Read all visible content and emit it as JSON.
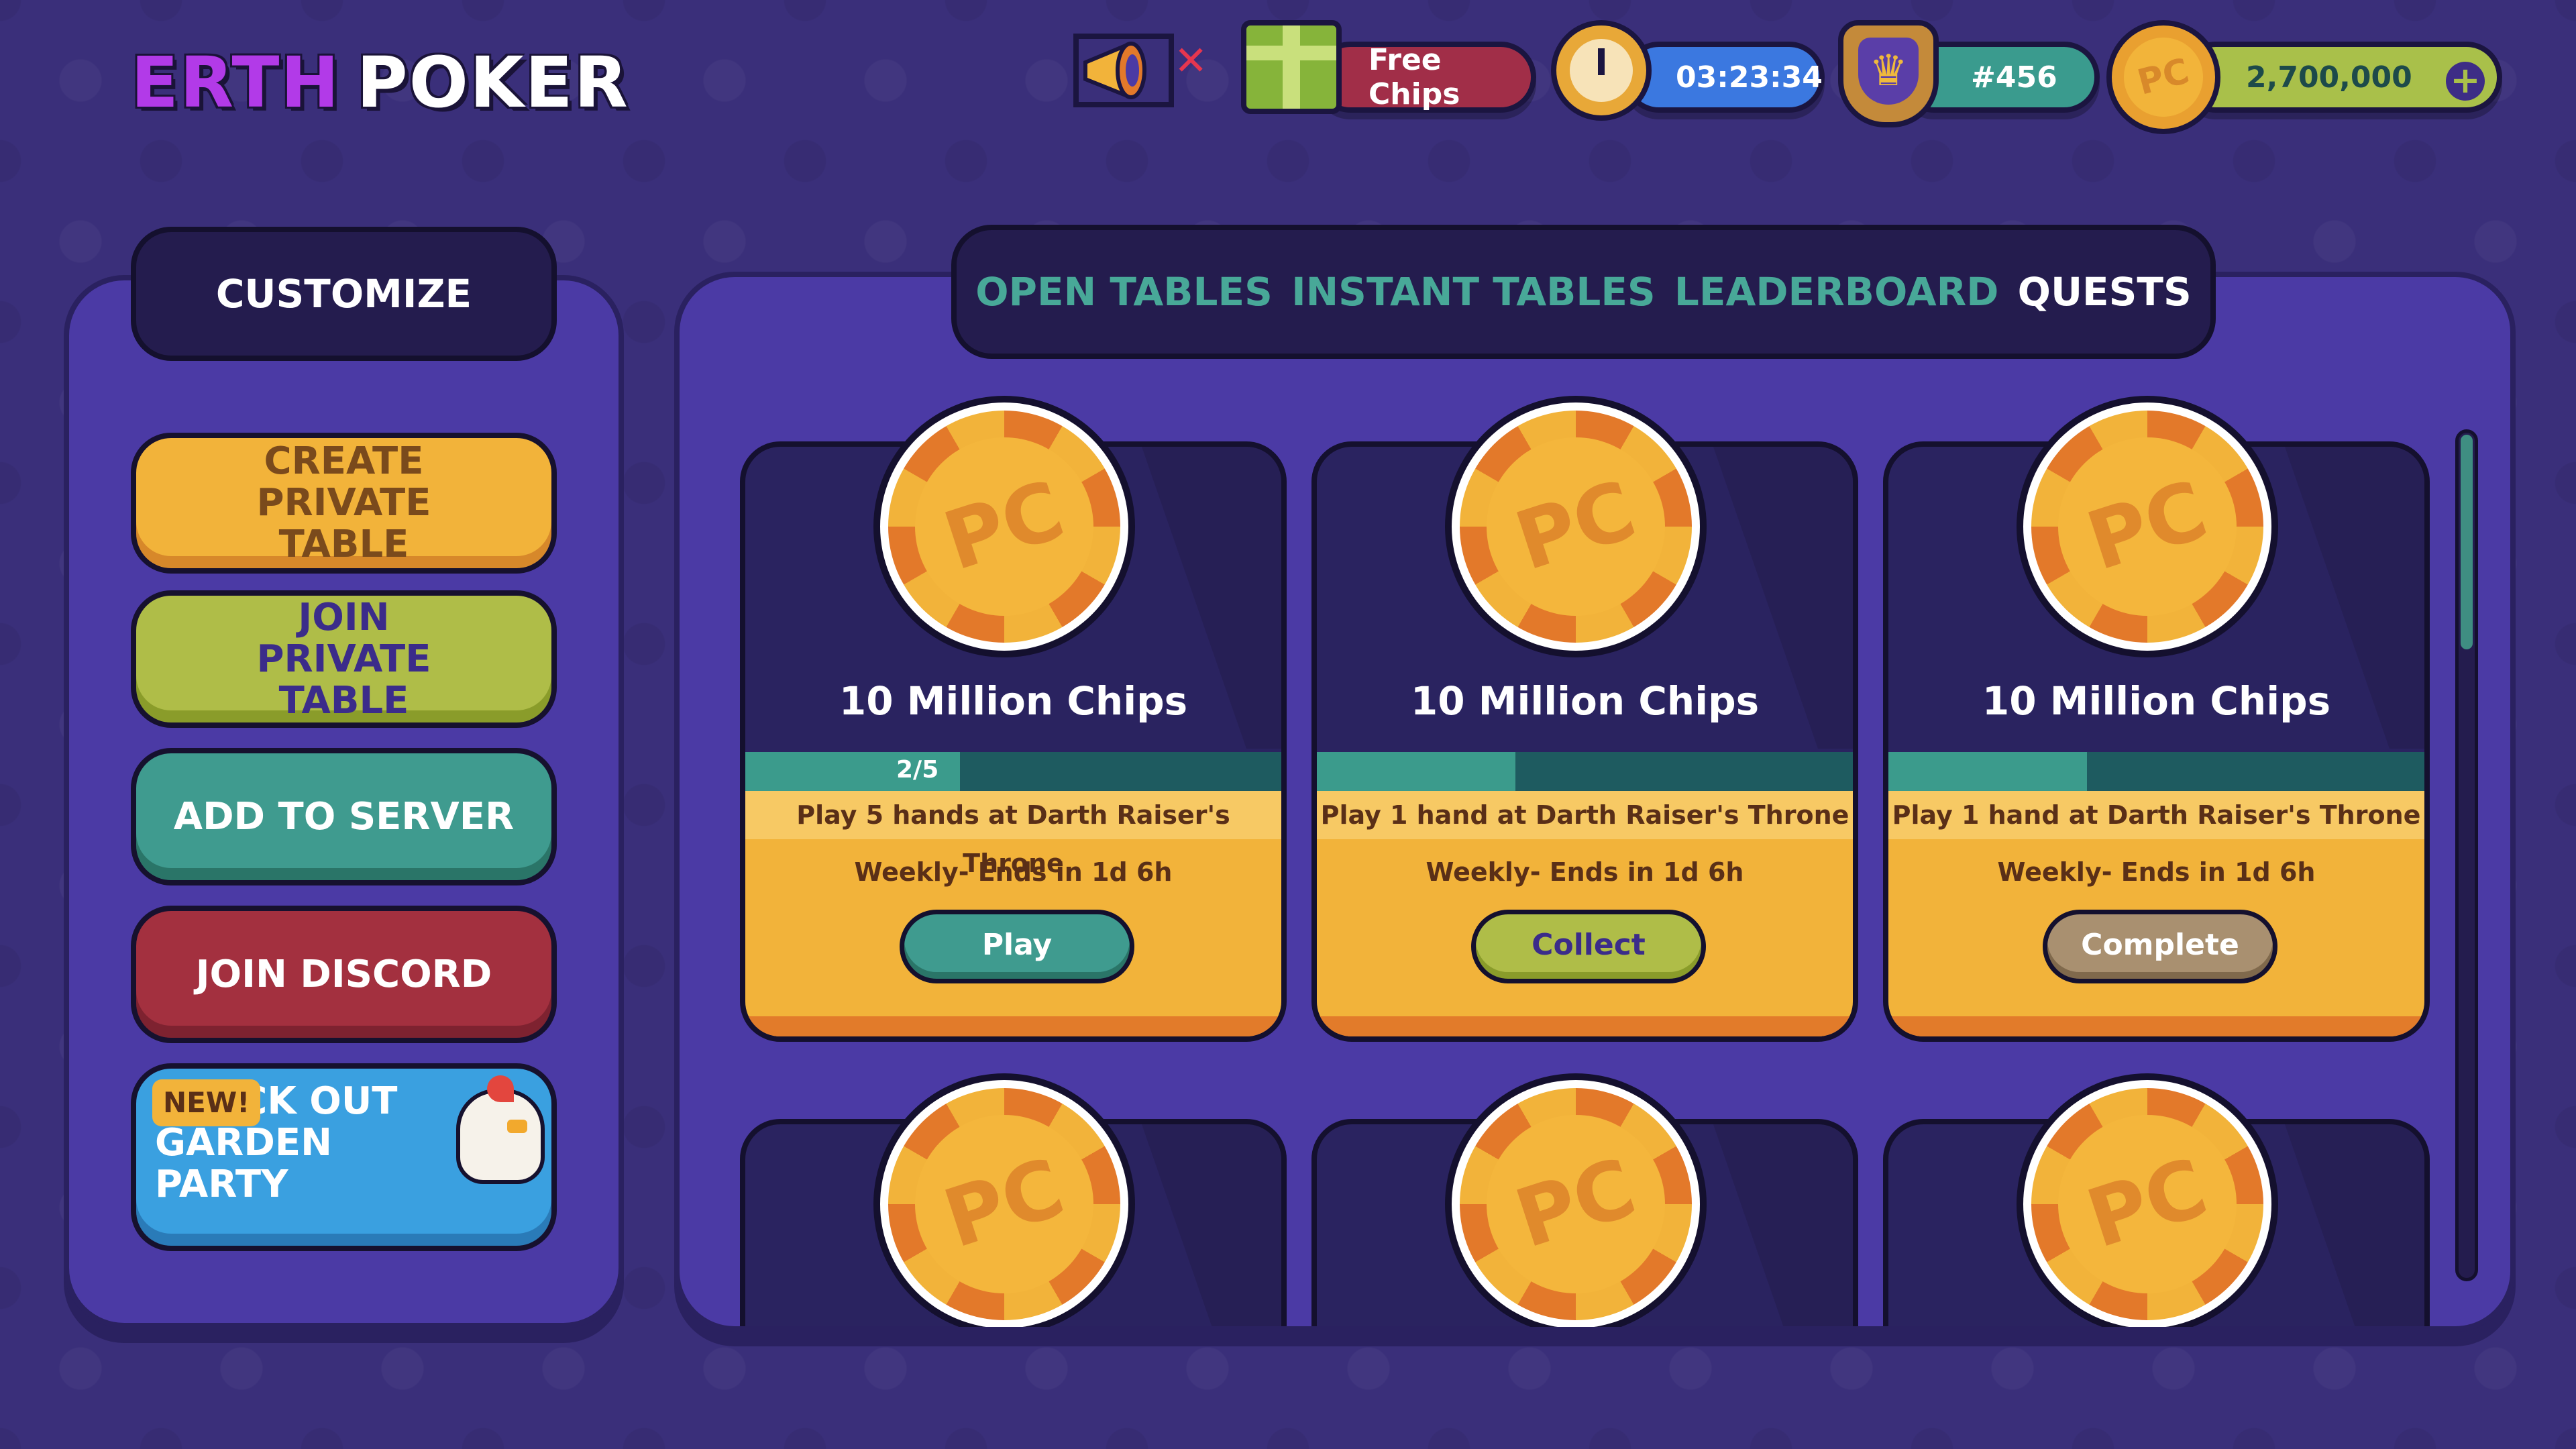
{
  "logo": {
    "part1": "ERTH",
    "part2": "POKER"
  },
  "hud": {
    "free_chips": "Free Chips",
    "timer": "03:23:34",
    "rank": "#456",
    "balance": "2,700,000",
    "plus": "+"
  },
  "sidebar": {
    "customize": "CUSTOMIZE",
    "create_private": "CREATE PRIVATE TABLE",
    "join_private": "JOIN PRIVATE TABLE",
    "add_to_server": "ADD TO SERVER",
    "join_discord": "JOIN DISCORD",
    "promo_badge": "NEW!",
    "promo_text": "CHECK OUT GARDEN PARTY"
  },
  "tabs": [
    {
      "label": "OPEN TABLES",
      "active": false
    },
    {
      "label": "INSTANT TABLES",
      "active": false
    },
    {
      "label": "LEADERBOARD",
      "active": false
    },
    {
      "label": "QUESTS",
      "active": true
    }
  ],
  "quests": [
    {
      "coin_label": "PC",
      "title": "10 Million Chips",
      "progress_text": "2/5",
      "progress": 0.4,
      "task": "Play 5 hands at Darth Raiser's Throne",
      "ends": "Weekly- Ends in 1d 6h",
      "button": "Play"
    },
    {
      "coin_label": "PC",
      "title": "10 Million Chips",
      "progress_text": "",
      "progress": 0.37,
      "task": "Play 1 hand at Darth Raiser's Throne",
      "ends": "Weekly- Ends in 1d 6h",
      "button": "Collect"
    },
    {
      "coin_label": "PC",
      "title": "10 Million Chips",
      "progress_text": "",
      "progress": 0.37,
      "task": "Play 1 hand at Darth Raiser's Throne",
      "ends": "Weekly- Ends in 1d 6h",
      "button": "Complete"
    },
    {
      "coin_label": "PC"
    },
    {
      "coin_label": "PC"
    },
    {
      "coin_label": "PC"
    }
  ],
  "colors": {
    "background": "#3a2f7a",
    "panel": "#4b3aa5",
    "tab_inactive": "#48a898",
    "tab_active": "#ffffff",
    "gold": "#f2b33a",
    "teal": "#3f9b8f",
    "olive": "#afbd48",
    "discord_red": "#a3303f"
  },
  "icons": [
    "megaphone-icon",
    "mute-x-icon",
    "gift-icon",
    "clock-icon",
    "crown-shield-icon",
    "coin-icon",
    "plus-icon",
    "chicken-icon"
  ]
}
